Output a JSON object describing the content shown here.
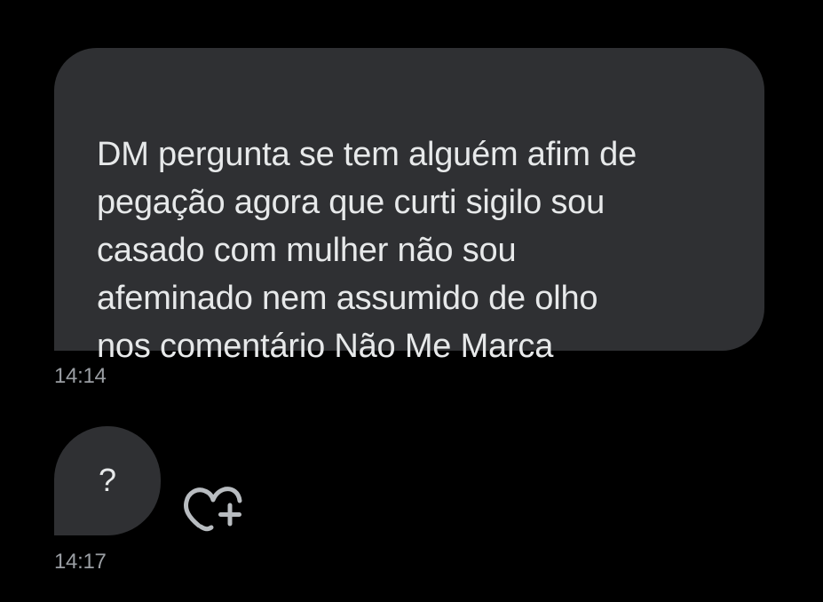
{
  "messages": [
    {
      "text": "DM pergunta se tem alguém afim de\npegação agora  que curti sigilo sou\ncasado com mulher não sou\nafeminado nem assumido de olho\nnos comentário  Não Me Marca",
      "time": "14:14"
    },
    {
      "text": "?",
      "time": "14:17"
    }
  ],
  "react_icon": "heart-plus-icon",
  "colors": {
    "background": "#000000",
    "bubble": "#2f3033",
    "text": "#e7e9ea",
    "timestamp": "#9a9ea3",
    "icon": "#b8bcc0"
  }
}
